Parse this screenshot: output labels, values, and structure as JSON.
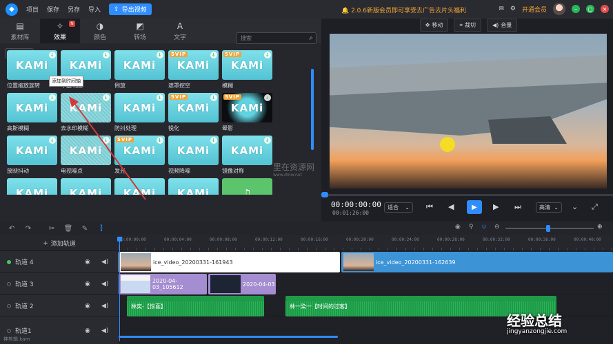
{
  "topbar": {
    "menu": [
      "项目",
      "保存",
      "另存",
      "导入"
    ],
    "export_label": "导出视频",
    "promo": "2.0.6新版会员即可享受去广告去片头福利",
    "vip_label": "开通会员"
  },
  "tabs": [
    {
      "label": "素材库",
      "icon": "media-library-icon"
    },
    {
      "label": "效果",
      "icon": "effects-icon",
      "badge": "N"
    },
    {
      "label": "颜色",
      "icon": "palette-icon"
    },
    {
      "label": "转场",
      "icon": "transition-icon"
    },
    {
      "label": "文字",
      "icon": "text-icon"
    }
  ],
  "filter": {
    "value": "全部",
    "search_placeholder": "搜索"
  },
  "tooltip": "添加到时间轴",
  "effects": [
    {
      "label": "位置缩放旋转",
      "vip": false
    },
    {
      "label": "不透明度",
      "vip": false
    },
    {
      "label": "倒放",
      "vip": false
    },
    {
      "label": "遮罩挖空",
      "vip": true
    },
    {
      "label": "模糊",
      "vip": true
    },
    {
      "label": "高斯模糊",
      "vip": false
    },
    {
      "label": "去水印模糊",
      "vip": false
    },
    {
      "label": "防抖处理",
      "vip": false
    },
    {
      "label": "锐化",
      "vip": true
    },
    {
      "label": "晕影",
      "vip": true
    },
    {
      "label": "放映抖动",
      "vip": false
    },
    {
      "label": "电视噪点",
      "vip": false
    },
    {
      "label": "发光",
      "vip": true
    },
    {
      "label": "视频降噪",
      "vip": false
    },
    {
      "label": "镜像对称",
      "vip": false
    }
  ],
  "kami_text": "KAMi",
  "vip_tag": "5VIP",
  "watermark_mid": {
    "title": "里在资源网",
    "url": "www.dmw.net"
  },
  "preview_toolbar": [
    "移动",
    "裁切",
    "音量"
  ],
  "player": {
    "current": "00:00:00:00",
    "total": "00:01:26:00",
    "fit": "适合",
    "quality": "高清"
  },
  "timeline": {
    "add_track": "添加轨道",
    "ruler": [
      "00:00:00:00",
      "00:00:04:00",
      "00:00:08:00",
      "00:00:12:00",
      "00:00:16:00",
      "00:00:20:00",
      "00:00:24:00",
      "00:00:28:00",
      "00:00:32:00",
      "00:00:36:00",
      "00:00:40:00"
    ],
    "tracks": [
      {
        "name": "轨道 4",
        "active": true
      },
      {
        "name": "轨道 3",
        "active": false
      },
      {
        "name": "轨道 2",
        "active": false
      },
      {
        "name": "轨道1",
        "active": false
      }
    ],
    "clips": {
      "t4a": "ice_video_20200331-161943",
      "t4b": "ice_video_20200331-162639",
      "t3a": "2020-04-03_105612",
      "t3b": "2020-04-03",
      "t2a": "林奕-【惊喜】",
      "t2b": "林一染一【时间的过客】"
    }
  },
  "footer_brand": "神剪辑.kam",
  "watermark_br": {
    "title": "经验总结",
    "url": "jingyanzongjie.com"
  },
  "colors": {
    "accent": "#2f8dff",
    "promo": "#f3a536",
    "vip": "#f0a43a",
    "clip_green": "#1f9a48",
    "clip_purple": "#a48dd0",
    "clip_blue": "#3c93d6"
  }
}
